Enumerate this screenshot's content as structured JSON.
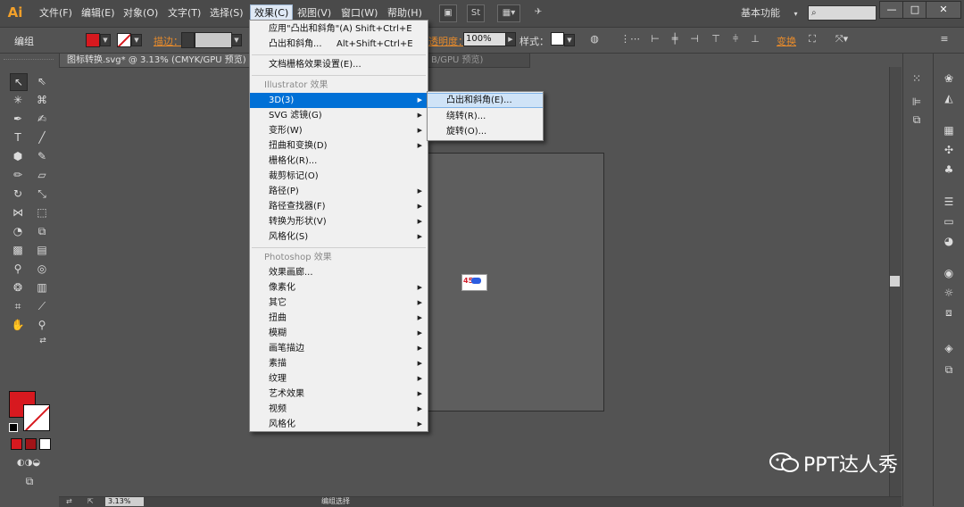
{
  "app": {
    "logo": "Ai",
    "workspace": "基本功能"
  },
  "menubar": {
    "items": [
      "文件(F)",
      "编辑(E)",
      "对象(O)",
      "文字(T)",
      "选择(S)",
      "效果(C)",
      "视图(V)",
      "窗口(W)",
      "帮助(H)"
    ],
    "active": "效果(C)",
    "st_icon": "St"
  },
  "window_controls": {
    "minimize": "—",
    "maximize": "□",
    "close": "✕"
  },
  "control_bar": {
    "selection": "编组",
    "stroke_label": "描边：",
    "opacity_label": "透明度：",
    "opacity_value": "100%",
    "style_label": "样式：",
    "transform_label": "变换"
  },
  "document": {
    "tab_title": "图标转换.svg* @ 3.13% (CMYK/GPU 预览)",
    "tab2_title": "B/GPU 预览)",
    "art_text": "45"
  },
  "status": {
    "zoom": "3.13%",
    "text": "编组选择"
  },
  "effect_menu": {
    "apply_last": {
      "label": "应用\"凸出和斜角\"(A)",
      "shortcut": "Shift+Ctrl+E"
    },
    "last_effect": {
      "label": "凸出和斜角...",
      "shortcut": "Alt+Shift+Ctrl+E"
    },
    "raster_settings": "文档栅格效果设置(E)...",
    "illustrator_header": "Illustrator 效果",
    "illustrator_items": [
      "3D(3)",
      "SVG 滤镜(G)",
      "变形(W)",
      "扭曲和变换(D)",
      "栅格化(R)...",
      "裁剪标记(O)",
      "路径(P)",
      "路径查找器(F)",
      "转换为形状(V)",
      "风格化(S)"
    ],
    "photoshop_header": "Photoshop 效果",
    "photoshop_items": [
      "效果画廊...",
      "像素化",
      "其它",
      "扭曲",
      "模糊",
      "画笔描边",
      "素描",
      "纹理",
      "艺术效果",
      "视频",
      "风格化"
    ]
  },
  "submenu_3d": {
    "items": [
      "凸出和斜角(E)...",
      "绕转(R)...",
      "旋转(O)..."
    ],
    "highlighted": "凸出和斜角(E)..."
  },
  "watermark": {
    "text": "PPT达人秀"
  },
  "colors": {
    "fill": "#d7191f",
    "accent_orange": "#e78b2c",
    "menu_highlight": "#0070d6"
  }
}
